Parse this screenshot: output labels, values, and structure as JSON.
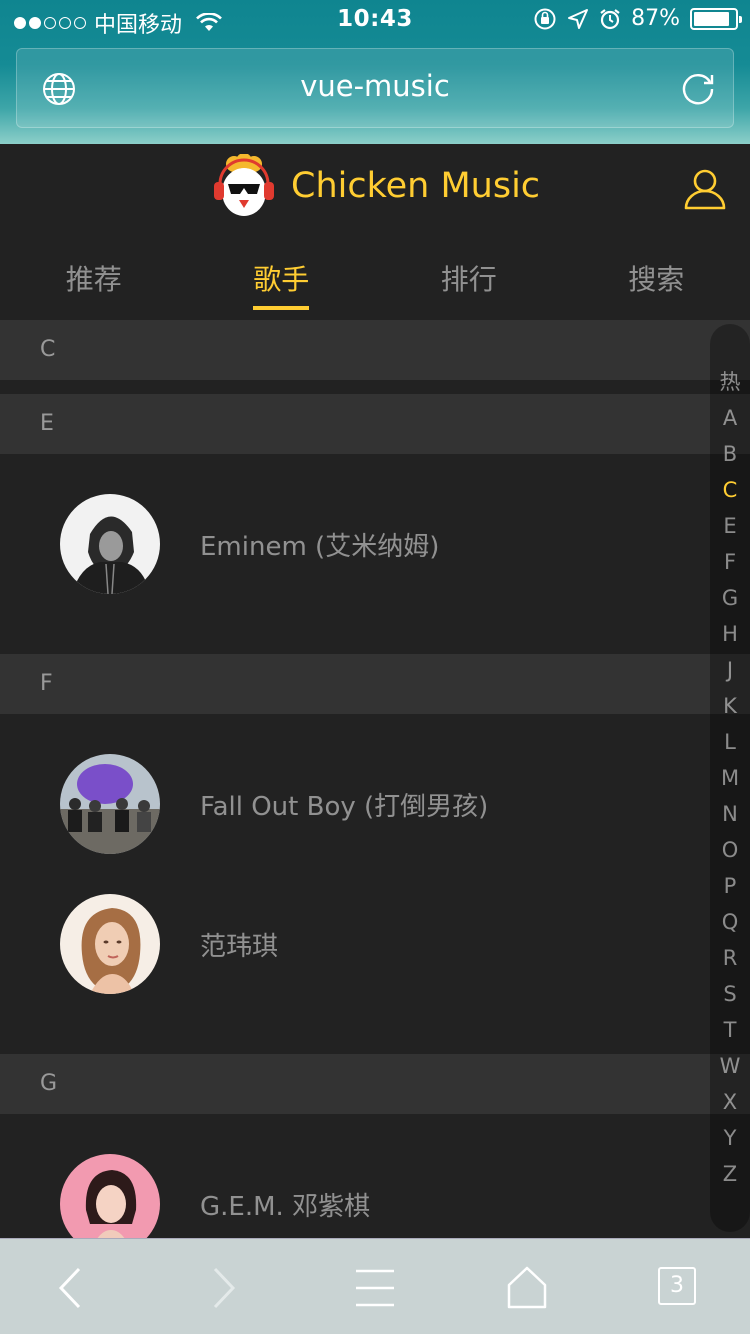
{
  "status_bar": {
    "carrier": "中国移动",
    "time": "10:43",
    "battery": "87%",
    "battery_level": 0.87
  },
  "browser": {
    "url_title": "vue-music",
    "tabs_count": "3"
  },
  "app": {
    "brand": "Chicken Music",
    "accent_color": "#ffcd32",
    "background_color": "#222222"
  },
  "tabs": [
    {
      "label": "推荐",
      "active": false
    },
    {
      "label": "歌手",
      "active": true
    },
    {
      "label": "排行",
      "active": false
    },
    {
      "label": "搜索",
      "active": false
    }
  ],
  "groups": [
    {
      "title": "C",
      "singers": []
    },
    {
      "title": "E",
      "singers": [
        {
          "name": "Eminem (艾米纳姆)"
        }
      ]
    },
    {
      "title": "F",
      "singers": [
        {
          "name": "Fall Out Boy (打倒男孩)"
        },
        {
          "name": "范玮琪"
        }
      ]
    },
    {
      "title": "G",
      "singers": [
        {
          "name": "G.E.M. 邓紫棋"
        }
      ]
    }
  ],
  "index_bar": [
    "热",
    "A",
    "B",
    "C",
    "E",
    "F",
    "G",
    "H",
    "J",
    "K",
    "L",
    "M",
    "N",
    "O",
    "P",
    "Q",
    "R",
    "S",
    "T",
    "W",
    "X",
    "Y",
    "Z"
  ],
  "index_active": "C",
  "icons": {
    "globe": "globe-icon",
    "reload": "reload-icon",
    "user": "user-icon",
    "back": "chevron-left-icon",
    "forward": "chevron-right-icon",
    "menu": "menu-icon",
    "home": "home-icon"
  }
}
